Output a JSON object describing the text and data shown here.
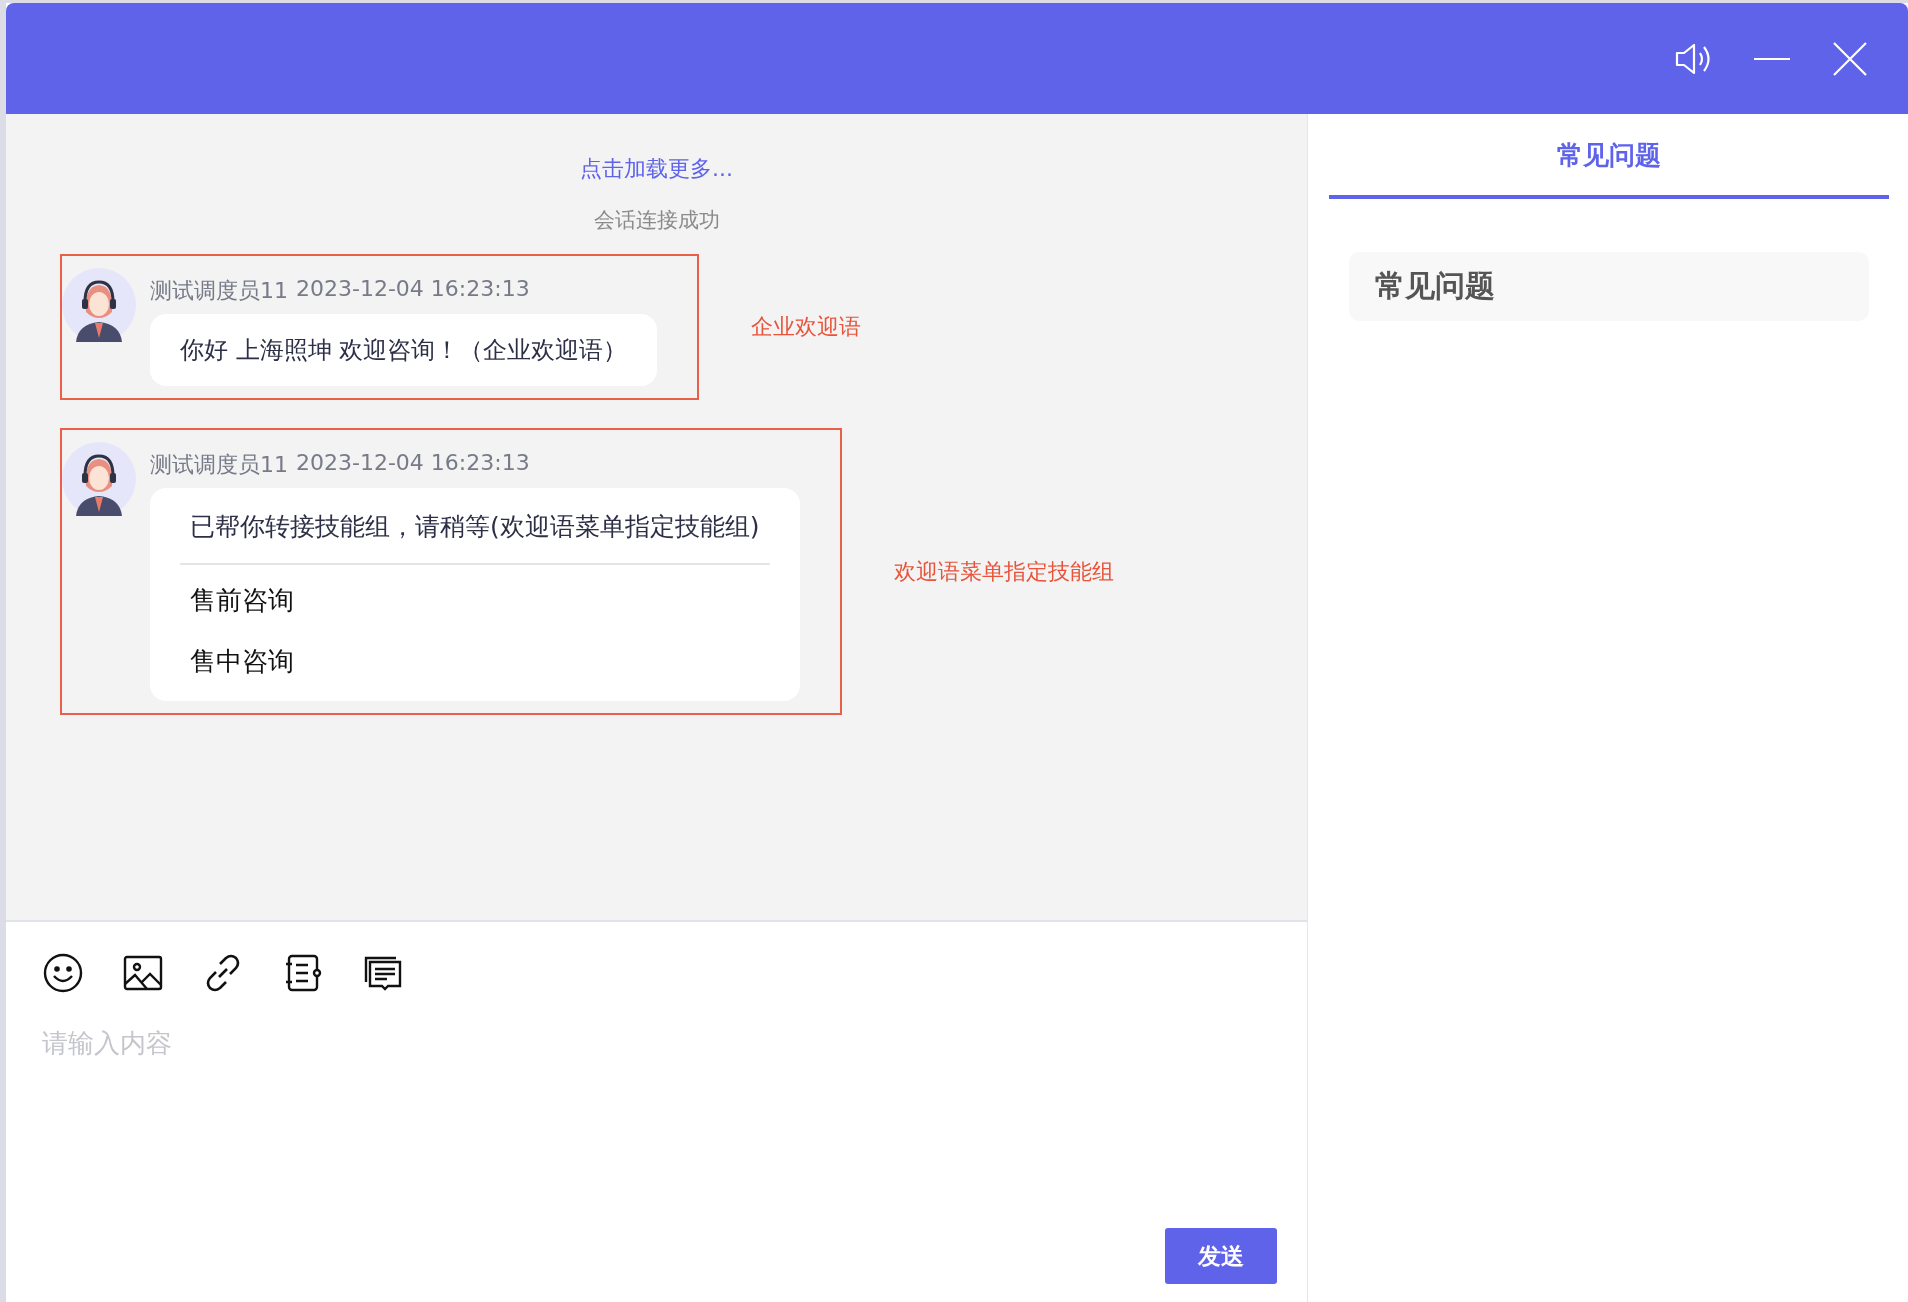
{
  "chat": {
    "load_more": "点击加载更多...",
    "system_notice": "会话连接成功",
    "messages": [
      {
        "kind": "text",
        "sender": "测试调度员11",
        "time": "2023-12-04 16:23:13",
        "text": "你好 上海照坤 欢迎咨询！（企业欢迎语）",
        "annotation": "企业欢迎语"
      },
      {
        "kind": "menu",
        "sender": "测试调度员11",
        "time": "2023-12-04 16:23:13",
        "text": "已帮你转接技能组，请稍等(欢迎语菜单指定技能组)",
        "options": [
          "售前咨询",
          "售中咨询"
        ],
        "annotation": "欢迎语菜单指定技能组"
      }
    ]
  },
  "composer": {
    "placeholder": "请输入内容",
    "send_button": "发送"
  },
  "side_panel": {
    "tabs": [
      {
        "label": "常见问题",
        "selected": true
      }
    ],
    "faq_title": "常见问题"
  }
}
